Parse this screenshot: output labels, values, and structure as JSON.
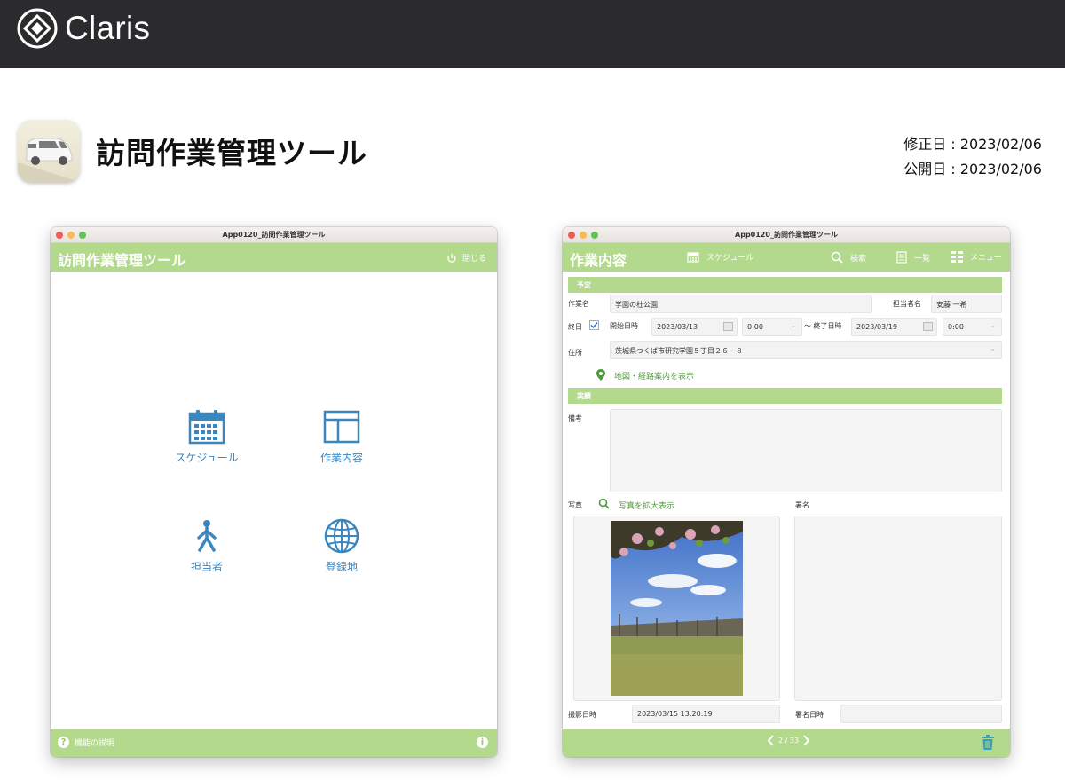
{
  "topbar": {
    "brand_name": "Claris"
  },
  "header": {
    "title": "訪問作業管理ツール",
    "modified": "修正日 : 2023/02/06",
    "published": "公開日 : 2023/02/06"
  },
  "win1": {
    "window_title": "App0120_訪問作業管理ツール",
    "heading": "訪問作業管理ツール",
    "close_label": "閉じる",
    "menu": {
      "schedule": "スケジュール",
      "work": "作業内容",
      "staff": "担当者",
      "location": "登録地"
    },
    "footer_help": "機能の説明",
    "help_glyph": "?",
    "info_glyph": "i"
  },
  "win2": {
    "window_title": "App0120_訪問作業管理ツール",
    "heading": "作業内容",
    "nav": {
      "schedule": "スケジュール",
      "search": "検索",
      "list": "一覧",
      "menu": "メニュー"
    },
    "section_plan": "予定",
    "work_name_label": "作業名",
    "work_name": "学園の杜公園",
    "staff_label": "担当者名",
    "staff": "安藤 一希",
    "allday_label": "終日",
    "start_label": "開始日時",
    "start_date": "2023/03/13",
    "start_time": "0:00",
    "end_label": "～ 終了日時",
    "end_date": "2023/03/19",
    "end_time": "0:00",
    "address_label": "住所",
    "address": "茨城県つくば市研究学園５丁目２６－８",
    "map_link": "地図・経路案内を表示",
    "section_actual": "実績",
    "notes_label": "備考",
    "photo_label": "写真",
    "photo_zoom": "写真を拡大表示",
    "signature_label": "署名",
    "shot_date_label": "撮影日時",
    "shot_date": "2023/03/15 13:20:19",
    "sign_date_label": "署名日時",
    "pager": "2 / 33"
  },
  "colors": {
    "accent_green": "#b3d98c",
    "icon_blue": "#3a86bf",
    "link_green": "#4f9a3c",
    "topbar": "#2b2b2d"
  }
}
